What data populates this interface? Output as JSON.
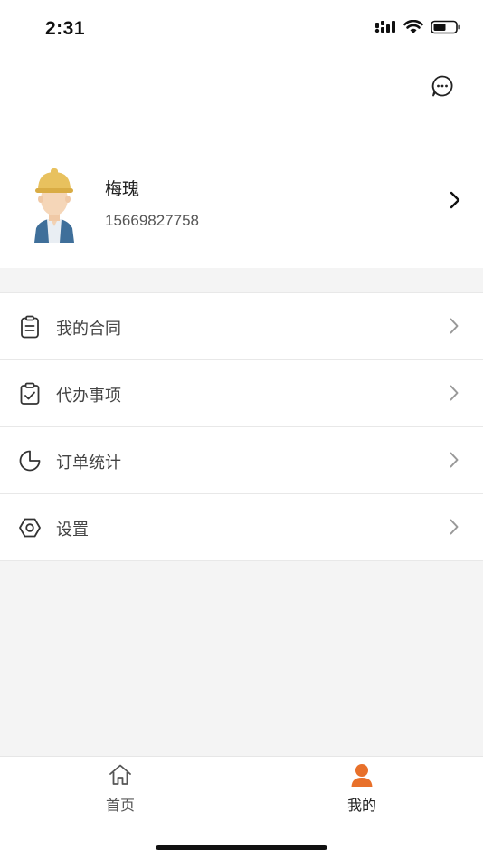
{
  "status_bar": {
    "time": "2:31",
    "signal_icon": "cellular-signal-icon",
    "wifi_icon": "wifi-icon",
    "battery_icon": "battery-icon"
  },
  "header": {
    "message_icon": "chat-bubble-icon",
    "profile": {
      "name": "梅瑰",
      "phone": "15669827758",
      "avatar": "construction-worker-avatar"
    }
  },
  "menu": {
    "items": [
      {
        "label": "我的合同",
        "icon": "clipboard-icon"
      },
      {
        "label": "代办事项",
        "icon": "clipboard-check-icon"
      },
      {
        "label": "订单统计",
        "icon": "pie-chart-icon"
      },
      {
        "label": "设置",
        "icon": "hexagon-settings-icon"
      }
    ]
  },
  "tabbar": {
    "tabs": [
      {
        "label": "首页",
        "icon": "home-icon",
        "active": false
      },
      {
        "label": "我的",
        "icon": "person-icon",
        "active": true
      }
    ],
    "active_color": "#e8702a"
  }
}
